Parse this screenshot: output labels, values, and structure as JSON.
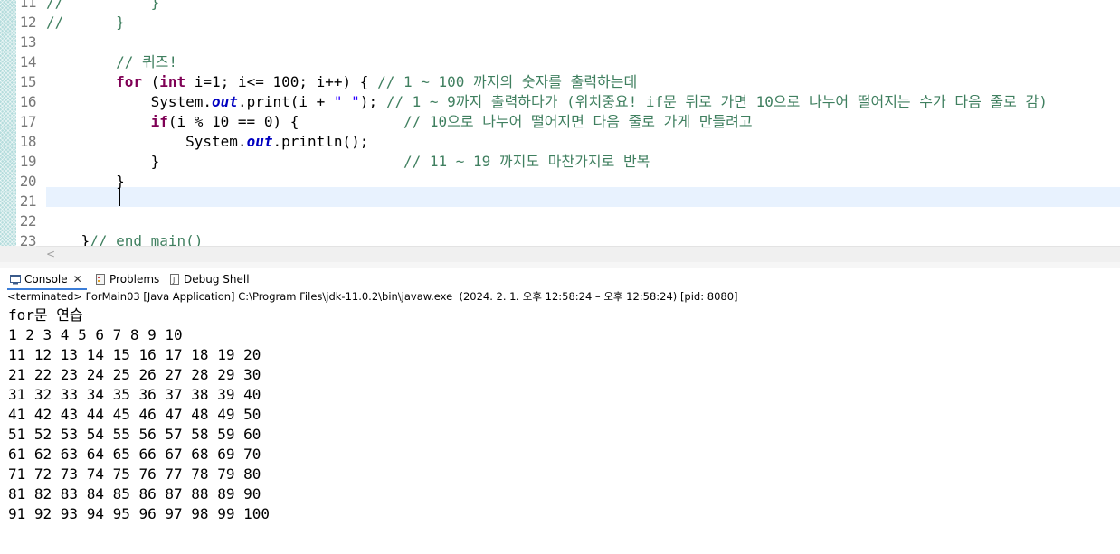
{
  "editor": {
    "lines": [
      {
        "num": "11",
        "segs": [
          {
            "t": "//          }",
            "c": "comment"
          }
        ]
      },
      {
        "num": "12",
        "segs": [
          {
            "t": "//      }",
            "c": "comment"
          }
        ]
      },
      {
        "num": "13",
        "segs": []
      },
      {
        "num": "14",
        "segs": [
          {
            "t": "        ",
            "c": "plain"
          },
          {
            "t": "// 퀴즈!",
            "c": "comment"
          }
        ]
      },
      {
        "num": "15",
        "segs": [
          {
            "t": "        ",
            "c": "plain"
          },
          {
            "t": "for",
            "c": "kw"
          },
          {
            "t": " (",
            "c": "plain"
          },
          {
            "t": "int",
            "c": "kw"
          },
          {
            "t": " i=1; i<= 100; i++) { ",
            "c": "plain"
          },
          {
            "t": "// 1 ~ 100 까지의 숫자를 출력하는데",
            "c": "comment"
          }
        ]
      },
      {
        "num": "16",
        "segs": [
          {
            "t": "            System.",
            "c": "plain"
          },
          {
            "t": "out",
            "c": "field"
          },
          {
            "t": ".print(i + ",
            "c": "plain"
          },
          {
            "t": "\" \"",
            "c": "str"
          },
          {
            "t": "); ",
            "c": "plain"
          },
          {
            "t": "// 1 ~ 9까지 출력하다가 (위치중요! if문 뒤로 가면 10으로 나누어 떨어지는 수가 다음 줄로 감)",
            "c": "comment"
          }
        ]
      },
      {
        "num": "17",
        "segs": [
          {
            "t": "            ",
            "c": "plain"
          },
          {
            "t": "if",
            "c": "kw"
          },
          {
            "t": "(i % 10 == 0) {            ",
            "c": "plain"
          },
          {
            "t": "// 10으로 나누어 떨어지면 다음 줄로 가게 만들려고",
            "c": "comment"
          }
        ]
      },
      {
        "num": "18",
        "segs": [
          {
            "t": "                System.",
            "c": "plain"
          },
          {
            "t": "out",
            "c": "field"
          },
          {
            "t": ".println();",
            "c": "plain"
          }
        ]
      },
      {
        "num": "19",
        "segs": [
          {
            "t": "            }                            ",
            "c": "plain"
          },
          {
            "t": "// 11 ~ 19 까지도 마찬가지로 반복",
            "c": "comment"
          }
        ]
      },
      {
        "num": "20",
        "segs": [
          {
            "t": "        }",
            "c": "plain"
          }
        ]
      },
      {
        "num": "21",
        "segs": []
      },
      {
        "num": "22",
        "segs": []
      },
      {
        "num": "23",
        "segs": [
          {
            "t": "    }",
            "c": "plain"
          },
          {
            "t": "// end main()",
            "c": "comment"
          }
        ]
      }
    ]
  },
  "views": {
    "tabs": {
      "console": "Console",
      "problems": "Problems",
      "debug": "Debug Shell"
    },
    "status": "<terminated> ForMain03 [Java Application] C:\\Program Files\\jdk-11.0.2\\bin\\javaw.exe  (2024. 2. 1. 오후 12:58:24 – 오후 12:58:24) [pid: 8080]"
  },
  "console_output": [
    "for문 연습",
    "1 2 3 4 5 6 7 8 9 10 ",
    "11 12 13 14 15 16 17 18 19 20 ",
    "21 22 23 24 25 26 27 28 29 30 ",
    "31 32 33 34 35 36 37 38 39 40 ",
    "41 42 43 44 45 46 47 48 49 50 ",
    "51 52 53 54 55 56 57 58 59 60 ",
    "61 62 63 64 65 66 67 68 69 70 ",
    "71 72 73 74 75 76 77 78 79 80 ",
    "81 82 83 84 85 86 87 88 89 90 ",
    "91 92 93 94 95 96 97 98 99 100 "
  ],
  "icons": {
    "console": "console-icon",
    "problems": "problems-icon",
    "debug": "debug-shell-icon",
    "close": "close-icon"
  }
}
